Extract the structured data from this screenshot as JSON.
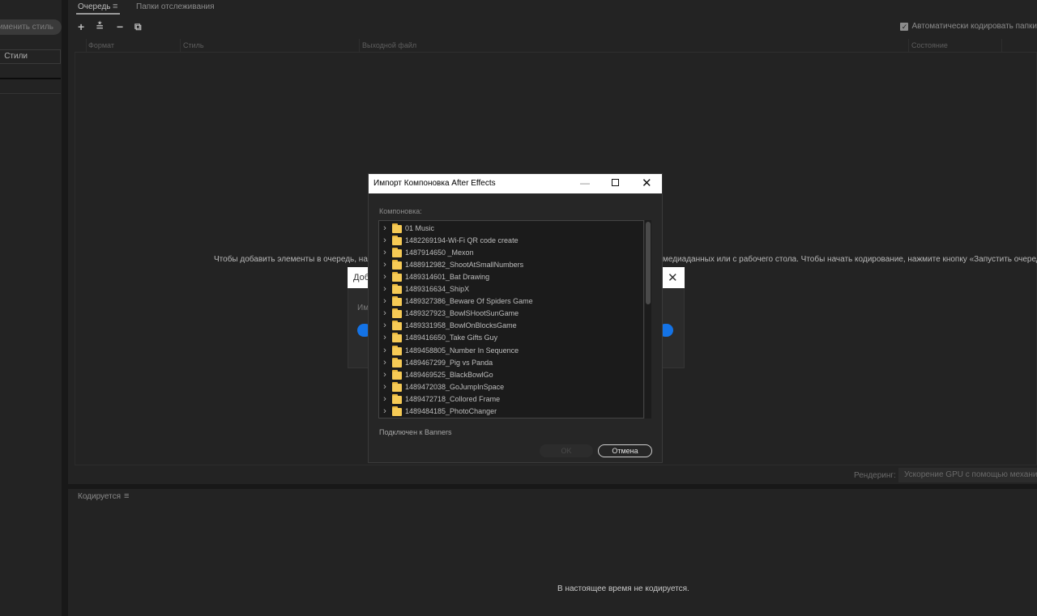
{
  "left_panel": {
    "apply_style_label": "Применить стиль",
    "tab_label": "Стили"
  },
  "queue": {
    "tab_label": "Очередь",
    "menu_icon": "hamburger-icon",
    "watch_folders_label": "Папки отслеживания",
    "toolbar": {
      "add_icon": "+",
      "settings_icon": "≛",
      "remove_icon": "−",
      "duplicate_icon": "⧉"
    },
    "auto_encode_label": "Автоматически кодировать папки",
    "columns": [
      "Формат",
      "Стиль",
      "Выходной файл",
      "Состояние"
    ],
    "hint_left": "Чтобы добавить элементы в очередь, нажм",
    "hint_right": "медиаданных или с рабочего стола. Чтобы начать кодирование, нажмите кнопку «Запустить очередь»."
  },
  "background_dialog": {
    "title": "Доб",
    "close_icon": "✕",
    "text": "Им"
  },
  "render": {
    "label": "Рендеринг:",
    "value": "Ускорение GPU с помощью механизма"
  },
  "encoding": {
    "tab_label": "Кодируется",
    "menu_icon": "hamburger-icon",
    "status": "В настоящее время не кодируется."
  },
  "import_dialog": {
    "title": "Импорт Компоновка After Effects",
    "minimize_icon": "—",
    "close_icon": "✕",
    "comp_label": "Компоновка:",
    "items": [
      "01 Music",
      "1482269194-Wi-Fi QR code create",
      "1487914650 _Mexon",
      "1488912982_ShootAtSmallNumbers",
      "1489314601_Bat Drawing",
      "1489316634_ShipX",
      "1489327386_Beware Of Spiders Game",
      "1489327923_BowlSHootSunGame",
      "1489331958_BowlOnBlocksGame",
      "1489416650_Take Gifts Guy",
      "1489458805_Number In Sequence",
      "1489467299_Pig vs Panda",
      "1489469525_BlackBowlGo",
      "1489472038_GoJumpInSpace",
      "1489472718_Collored Frame",
      "1489484185_PhotoChanger"
    ],
    "linked_label": "Подключен к Banners",
    "ok_label": "OK",
    "cancel_label": "Отмена"
  }
}
